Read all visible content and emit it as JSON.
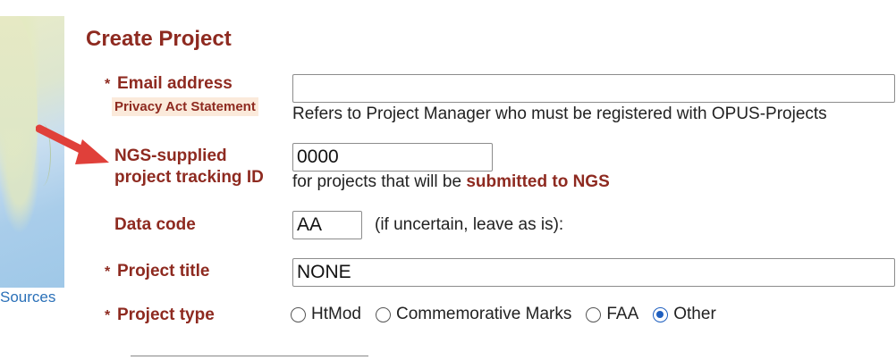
{
  "map": {
    "attribution": "Sources"
  },
  "form": {
    "title": "Create Project",
    "required_marker": "*",
    "email": {
      "label": "Email address",
      "privacy_link": "Privacy Act Statement",
      "value": "",
      "help": "Refers to Project Manager who must be registered with OPUS-Projects"
    },
    "tracking": {
      "label_line1": "NGS-supplied",
      "label_line2": "project tracking ID",
      "value": "0000",
      "help_prefix": "for projects that will be",
      "help_emphasis": "submitted to NGS"
    },
    "data_code": {
      "label": "Data code",
      "value": "AA",
      "help": "(if uncertain, leave as is):"
    },
    "project_title": {
      "label": "Project title",
      "value": "NONE"
    },
    "project_type": {
      "label": "Project type",
      "options": [
        "HtMod",
        "Commemorative Marks",
        "FAA",
        "Other"
      ],
      "selected": "Other"
    }
  },
  "colors": {
    "label": "#8e2a20",
    "link": "#2a70b8",
    "radio_selected": "#1f5fbf",
    "arrow": "#e0403a"
  },
  "icons": {
    "pointer": "red-arrow-icon"
  }
}
